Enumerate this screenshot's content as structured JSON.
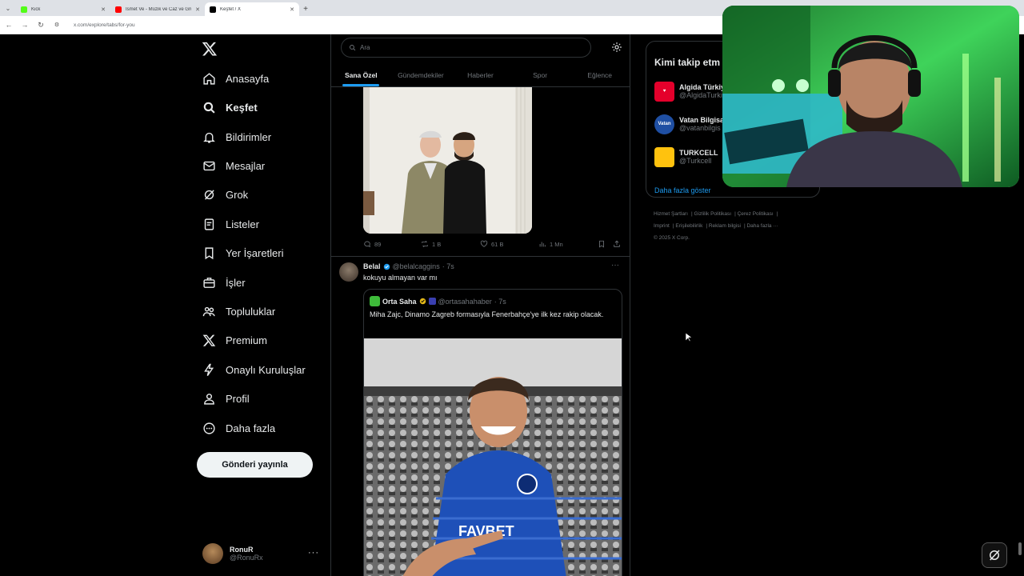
{
  "browser": {
    "tabs": [
      {
        "label": "Kick",
        "color": "#53fc18"
      },
      {
        "label": "İsmet Ve - Müzik ve Caz ve Grup",
        "color": "#ff0000"
      },
      {
        "label": "Keşfet / X",
        "color": "#000000"
      }
    ],
    "url": "x.com/explore/tabs/for-you"
  },
  "sidebar": {
    "items": [
      {
        "label": "Anasayfa",
        "icon": "home-icon"
      },
      {
        "label": "Keşfet",
        "icon": "search-icon"
      },
      {
        "label": "Bildirimler",
        "icon": "bell-icon"
      },
      {
        "label": "Mesajlar",
        "icon": "mail-icon"
      },
      {
        "label": "Grok",
        "icon": "grok-icon"
      },
      {
        "label": "Listeler",
        "icon": "list-icon"
      },
      {
        "label": "Yer İşaretleri",
        "icon": "bookmark-icon"
      },
      {
        "label": "İşler",
        "icon": "briefcase-icon"
      },
      {
        "label": "Topluluklar",
        "icon": "people-icon"
      },
      {
        "label": "Premium",
        "icon": "x-icon"
      },
      {
        "label": "Onaylı Kuruluşlar",
        "icon": "lightning-icon"
      },
      {
        "label": "Profil",
        "icon": "person-icon"
      },
      {
        "label": "Daha fazla",
        "icon": "more-circle-icon"
      }
    ],
    "post_button": "Gönderi yayınla",
    "account": {
      "name": "RonuR",
      "handle": "@RonuRx"
    }
  },
  "main": {
    "search_placeholder": "Ara",
    "tabs": [
      "Sana Özel",
      "Gündemdekiler",
      "Haberler",
      "Spor",
      "Eğlence"
    ],
    "post1": {
      "replies": "89",
      "reposts": "1 B",
      "likes": "61 B",
      "views": "1 Mn"
    },
    "post2": {
      "name": "Belal",
      "handle": "@belalcaggins",
      "time": "· 7s",
      "text": "kokuyu almayan var mı",
      "quote": {
        "name": "Orta Saha",
        "handle": "@ortasahahaber",
        "time": "· 7s",
        "text": "Miha Zajc, Dinamo Zagreb formasıyla Fenerbahçe'ye ilk kez rakip olacak.",
        "jersey_text": "FAVBET"
      }
    }
  },
  "right": {
    "follow_title": "Kimi takip etm",
    "suggestions": [
      {
        "name": "Algida Türkiy",
        "handle": "@AlgidaTurki",
        "color": "#e4002b"
      },
      {
        "name": "Vatan Bilgisa",
        "handle": "@vatanbilgis",
        "color": "#1f4fa3",
        "logo": "Vatan"
      },
      {
        "name": "TURKCELL",
        "handle": "@Turkcell",
        "color": "#ffc20e"
      }
    ],
    "show_more": "Daha fazla göster",
    "footer": [
      "Hizmet Şartları",
      "Gizlilik Politikası",
      "Çerez Politikası",
      "Imprint",
      "Erişilebilirlik",
      "Reklam bilgisi",
      "Daha fazla ···",
      "© 2025 X Corp."
    ]
  }
}
